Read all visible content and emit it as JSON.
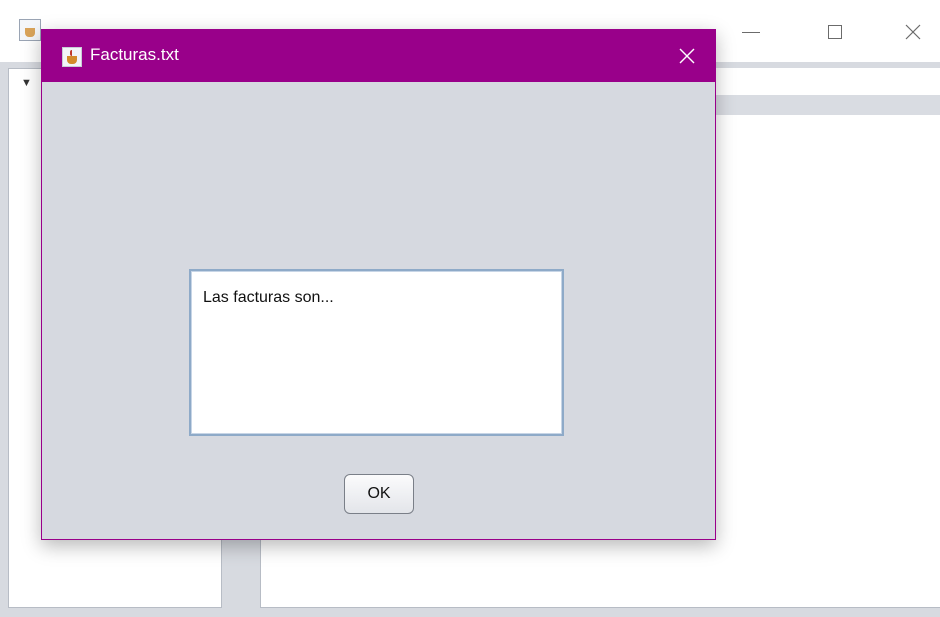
{
  "dialog": {
    "title": "Facturas.txt",
    "message": "Las facturas son...",
    "ok_label": "OK",
    "accent_color": "#99008a",
    "icon": "java-app-icon"
  },
  "background_window": {
    "controls": [
      "minimize-icon",
      "maximize-icon",
      "close-icon"
    ],
    "tree_toggle_glyph": "▼"
  }
}
